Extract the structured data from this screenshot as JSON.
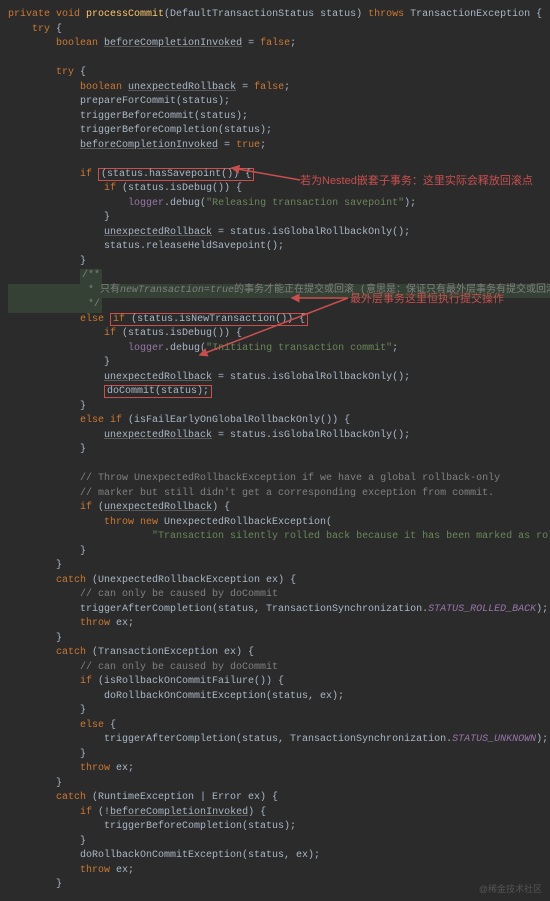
{
  "code": {
    "l1": "private void processCommit(DefaultTransactionStatus status) throws TransactionException {",
    "l2": "    try {",
    "l3": "        boolean beforeCompletionInvoked = false;",
    "l4": "",
    "l5": "        try {",
    "l6": "            boolean unexpectedRollback = false;",
    "l7": "            prepareForCommit(status);",
    "l8": "            triggerBeforeCommit(status);",
    "l9": "            triggerBeforeCompletion(status);",
    "l10": "            beforeCompletionInvoked = true;",
    "l11": "",
    "l12a": "            if ",
    "l12b": "(status.hasSavepoint()) {",
    "l13": "                if (status.isDebug()) {",
    "l14": "                    logger.debug(\"Releasing transaction savepoint\");",
    "l15": "                }",
    "l16": "                unexpectedRollback = status.isGlobalRollbackOnly();",
    "l17": "                status.releaseHeldSavepoint();",
    "l18": "            }",
    "l19a": "            /**",
    "l19b": "             * 只有newTransaction=true的事务才能正在提交或回滚 (意思是：保证只有最外层事务有提交或回滚的权限)",
    "l19c": "             */",
    "l20a": "            else ",
    "l20b": "if (status.isNewTransaction()) {",
    "l21": "                if (status.isDebug()) {",
    "l22": "                    logger.debug(\"Initiating transaction commit\";",
    "l23": "                }",
    "l24": "                unexpectedRollback = status.isGlobalRollbackOnly();",
    "l25": "                doCommit(status);",
    "l26": "            }",
    "l27": "            else if (isFailEarlyOnGlobalRollbackOnly()) {",
    "l28": "                unexpectedRollback = status.isGlobalRollbackOnly();",
    "l29": "            }",
    "l30": "",
    "l31": "            // Throw UnexpectedRollbackException if we have a global rollback-only",
    "l32": "            // marker but still didn't get a corresponding exception from commit.",
    "l33": "            if (unexpectedRollback) {",
    "l34": "                throw new UnexpectedRollbackException(",
    "l35": "                        \"Transaction silently rolled back because it has been marked as rollback-o",
    "l36": "            }",
    "l37": "        }",
    "l38": "        catch (UnexpectedRollbackException ex) {",
    "l39": "            // can only be caused by doCommit",
    "l40": "            triggerAfterCompletion(status, TransactionSynchronization.STATUS_ROLLED_BACK);",
    "l41": "            throw ex;",
    "l42": "        }",
    "l43": "        catch (TransactionException ex) {",
    "l44": "            // can only be caused by doCommit",
    "l45": "            if (isRollbackOnCommitFailure()) {",
    "l46": "                doRollbackOnCommitException(status, ex);",
    "l47": "            }",
    "l48": "            else {",
    "l49": "                triggerAfterCompletion(status, TransactionSynchronization.STATUS_UNKNOWN);",
    "l50": "            }",
    "l51": "            throw ex;",
    "l52": "        }",
    "l53": "        catch (RuntimeException | Error ex) {",
    "l54": "            if (!beforeCompletionInvoked) {",
    "l55": "                triggerBeforeCompletion(status);",
    "l56": "            }",
    "l57": "            doRollbackOnCommitException(status, ex);",
    "l58": "            throw ex;",
    "l59": "        }"
  },
  "annotations": {
    "a1": "若为Nested嵌套子事务：这里实际会释放回滚点",
    "a2": "最外层事务这里恒执行提交操作"
  },
  "watermark": "@稀金技术社区"
}
